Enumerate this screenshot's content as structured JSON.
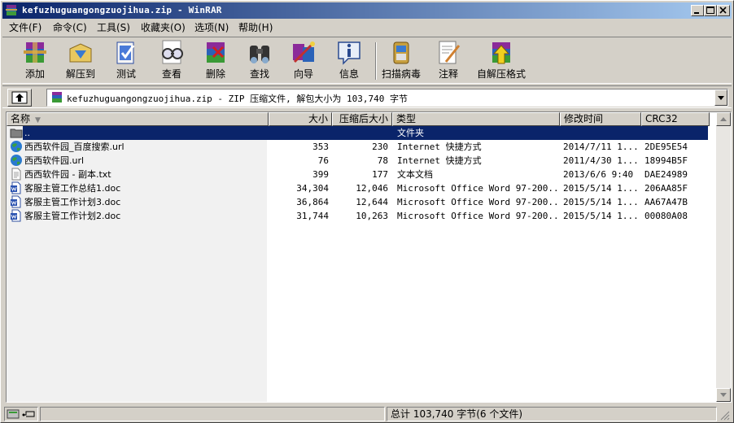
{
  "window": {
    "title": "kefuzhuguangongzuojihua.zip - WinRAR",
    "icon": "winrar-icon"
  },
  "menu": [
    "文件(F)",
    "命令(C)",
    "工具(S)",
    "收藏夹(O)",
    "选项(N)",
    "帮助(H)"
  ],
  "toolbar": [
    {
      "label": "添加",
      "icon": "add-archive-icon"
    },
    {
      "label": "解压到",
      "icon": "extract-to-icon"
    },
    {
      "label": "测试",
      "icon": "test-icon"
    },
    {
      "label": "查看",
      "icon": "view-icon"
    },
    {
      "label": "删除",
      "icon": "delete-icon"
    },
    {
      "label": "查找",
      "icon": "find-icon"
    },
    {
      "label": "向导",
      "icon": "wizard-icon"
    },
    {
      "label": "信息",
      "icon": "info-icon"
    },
    {
      "label": "扫描病毒",
      "icon": "virus-scan-icon"
    },
    {
      "label": "注释",
      "icon": "comment-icon"
    },
    {
      "label": "自解压格式",
      "icon": "sfx-icon"
    }
  ],
  "address": {
    "text": "kefuzhuguangongzuojihua.zip - ZIP 压缩文件, 解包大小为 103,740 字节"
  },
  "columns": {
    "name": "名称",
    "size": "大小",
    "packed": "压缩后大小",
    "type": "类型",
    "modified": "修改时间",
    "crc": "CRC32"
  },
  "files": [
    {
      "name": "..",
      "size": "",
      "packed": "",
      "type": "文件夹",
      "modified": "",
      "crc": "",
      "icon": "folder-up-icon",
      "selected": true
    },
    {
      "name": "西西软件园_百度搜索.url",
      "size": "353",
      "packed": "230",
      "type": "Internet 快捷方式",
      "modified": "2014/7/11 1...",
      "crc": "2DE95E54",
      "icon": "globe-icon"
    },
    {
      "name": "西西软件园.url",
      "size": "76",
      "packed": "78",
      "type": "Internet 快捷方式",
      "modified": "2011/4/30 1...",
      "crc": "18994B5F",
      "icon": "globe-icon"
    },
    {
      "name": "西西软件园 - 副本.txt",
      "size": "399",
      "packed": "177",
      "type": "文本文档",
      "modified": "2013/6/6 9:40",
      "crc": "DAE24989",
      "icon": "text-file-icon"
    },
    {
      "name": "客服主管工作总结1.doc",
      "size": "34,304",
      "packed": "12,046",
      "type": "Microsoft Office Word 97-200...",
      "modified": "2015/5/14 1...",
      "crc": "206AA85F",
      "icon": "word-doc-icon"
    },
    {
      "name": "客服主管工作计划3.doc",
      "size": "36,864",
      "packed": "12,644",
      "type": "Microsoft Office Word 97-200...",
      "modified": "2015/5/14 1...",
      "crc": "AA67A47B",
      "icon": "word-doc-icon"
    },
    {
      "name": "客服主管工作计划2.doc",
      "size": "31,744",
      "packed": "10,263",
      "type": "Microsoft Office Word 97-200...",
      "modified": "2015/5/14 1...",
      "crc": "00080A08",
      "icon": "word-doc-icon"
    }
  ],
  "status": {
    "right": "总计 103,740 字节(6 个文件)"
  }
}
